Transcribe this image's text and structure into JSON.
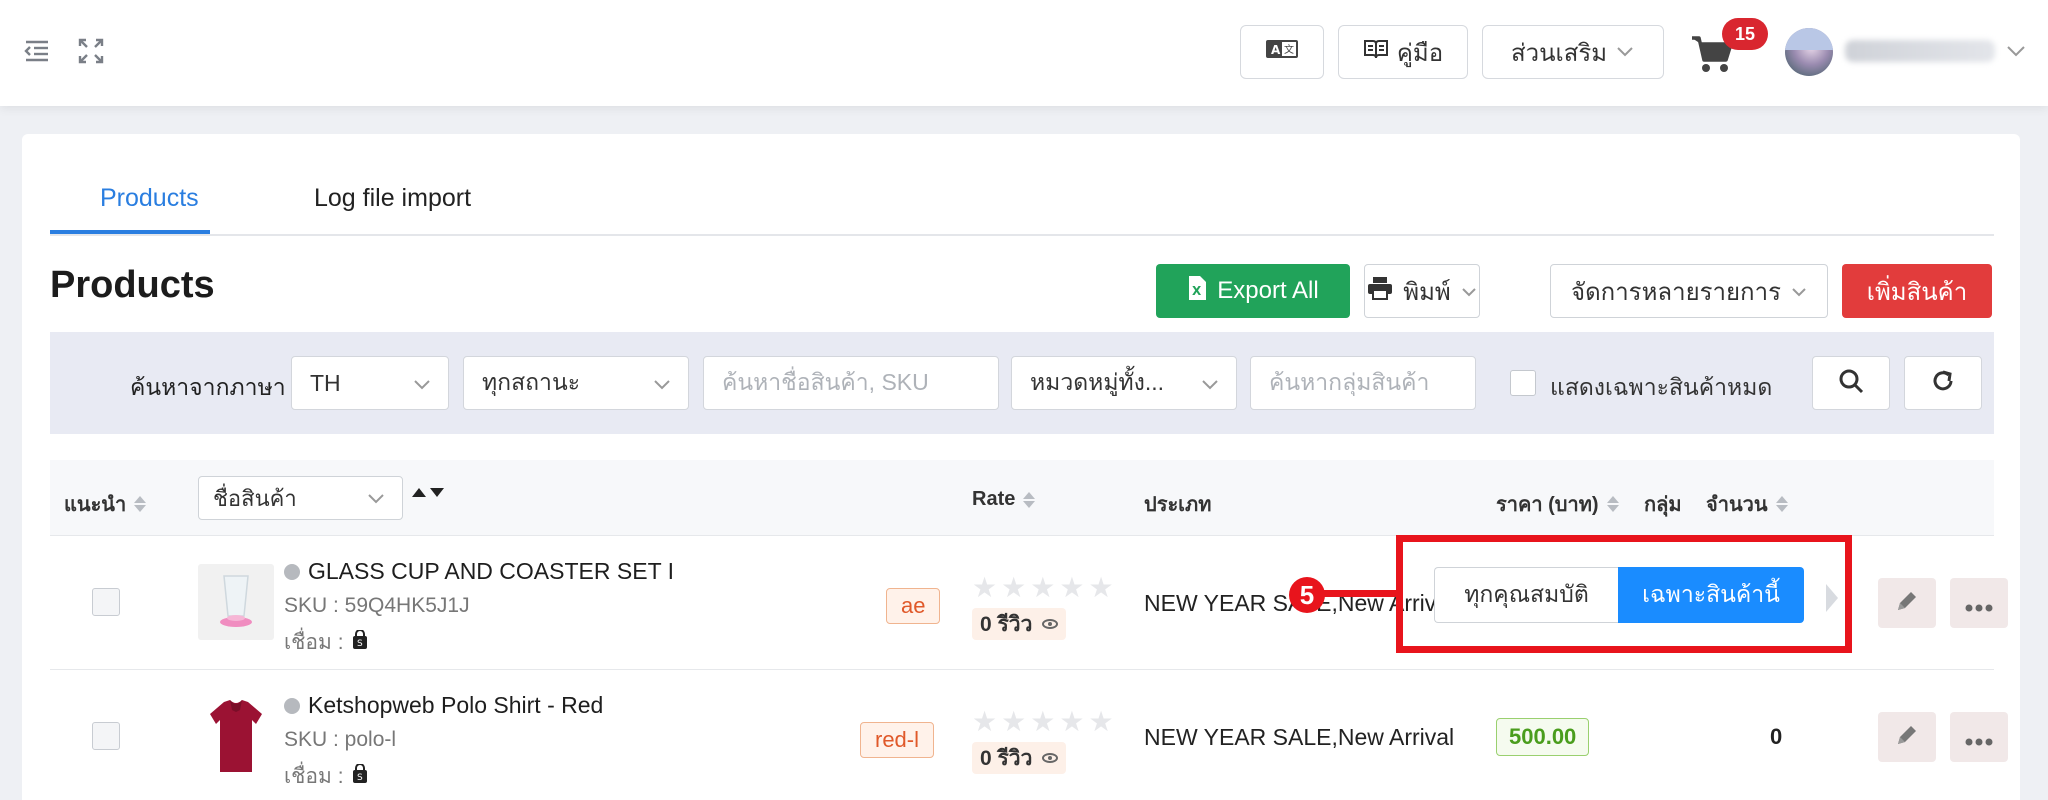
{
  "topbar": {
    "manual_label": "คู่มือ",
    "addons_label": "ส่วนเสริม",
    "cart_count": "15"
  },
  "tabs": [
    {
      "label": "Products",
      "active": true
    },
    {
      "label": "Log file import",
      "active": false
    }
  ],
  "page": {
    "title": "Products",
    "export_label": "Export All",
    "print_label": "พิมพ์",
    "bulk_label": "จัดการหลายรายการ",
    "add_label": "เพิ่มสินค้า"
  },
  "filters": {
    "lang_label": "ค้นหาจากภาษา",
    "lang_value": "TH",
    "status_value": "ทุกสถานะ",
    "search_placeholder": "ค้นหาชื่อสินค้า, SKU",
    "category_value": "หมวดหมู่ทั้ง...",
    "group_placeholder": "ค้นหากลุ่มสินค้า",
    "soldout_label": "แสดงเฉพาะสินค้าหมด"
  },
  "table": {
    "col_recommend": "แนะนำ",
    "col_name_select": "ชื่อสินค้า",
    "col_rate": "Rate",
    "col_type": "ประเภท",
    "col_price": "ราคา (บาท)",
    "col_group": "กลุ่ม",
    "col_qty": "จำนวน",
    "rows": [
      {
        "name": "GLASS CUP AND COASTER SET I",
        "sku": "SKU : 59Q4HK5J1J",
        "link_label": "เชื่อม :",
        "tag": "ae",
        "reviews": "0 รีวิว",
        "category": "NEW YEAR SALE,New Arrival",
        "price": "",
        "qty": ""
      },
      {
        "name": "Ketshopweb Polo Shirt - Red",
        "sku": "SKU : polo-l",
        "link_label": "เชื่อม :",
        "tag": "red-l",
        "reviews": "0 รีวิว",
        "category": "NEW YEAR SALE,New Arrival",
        "price": "500.00",
        "qty": "0"
      }
    ]
  },
  "popover": {
    "step_number": "5",
    "all_attrs_label": "ทุกคุณสมบัติ",
    "this_product_label": "เฉพาะสินค้านี้"
  },
  "colors": {
    "accent_blue": "#2a7ee0",
    "export_green": "#21a35a",
    "add_red": "#e23c3c",
    "annotation_red": "#e8141c"
  }
}
